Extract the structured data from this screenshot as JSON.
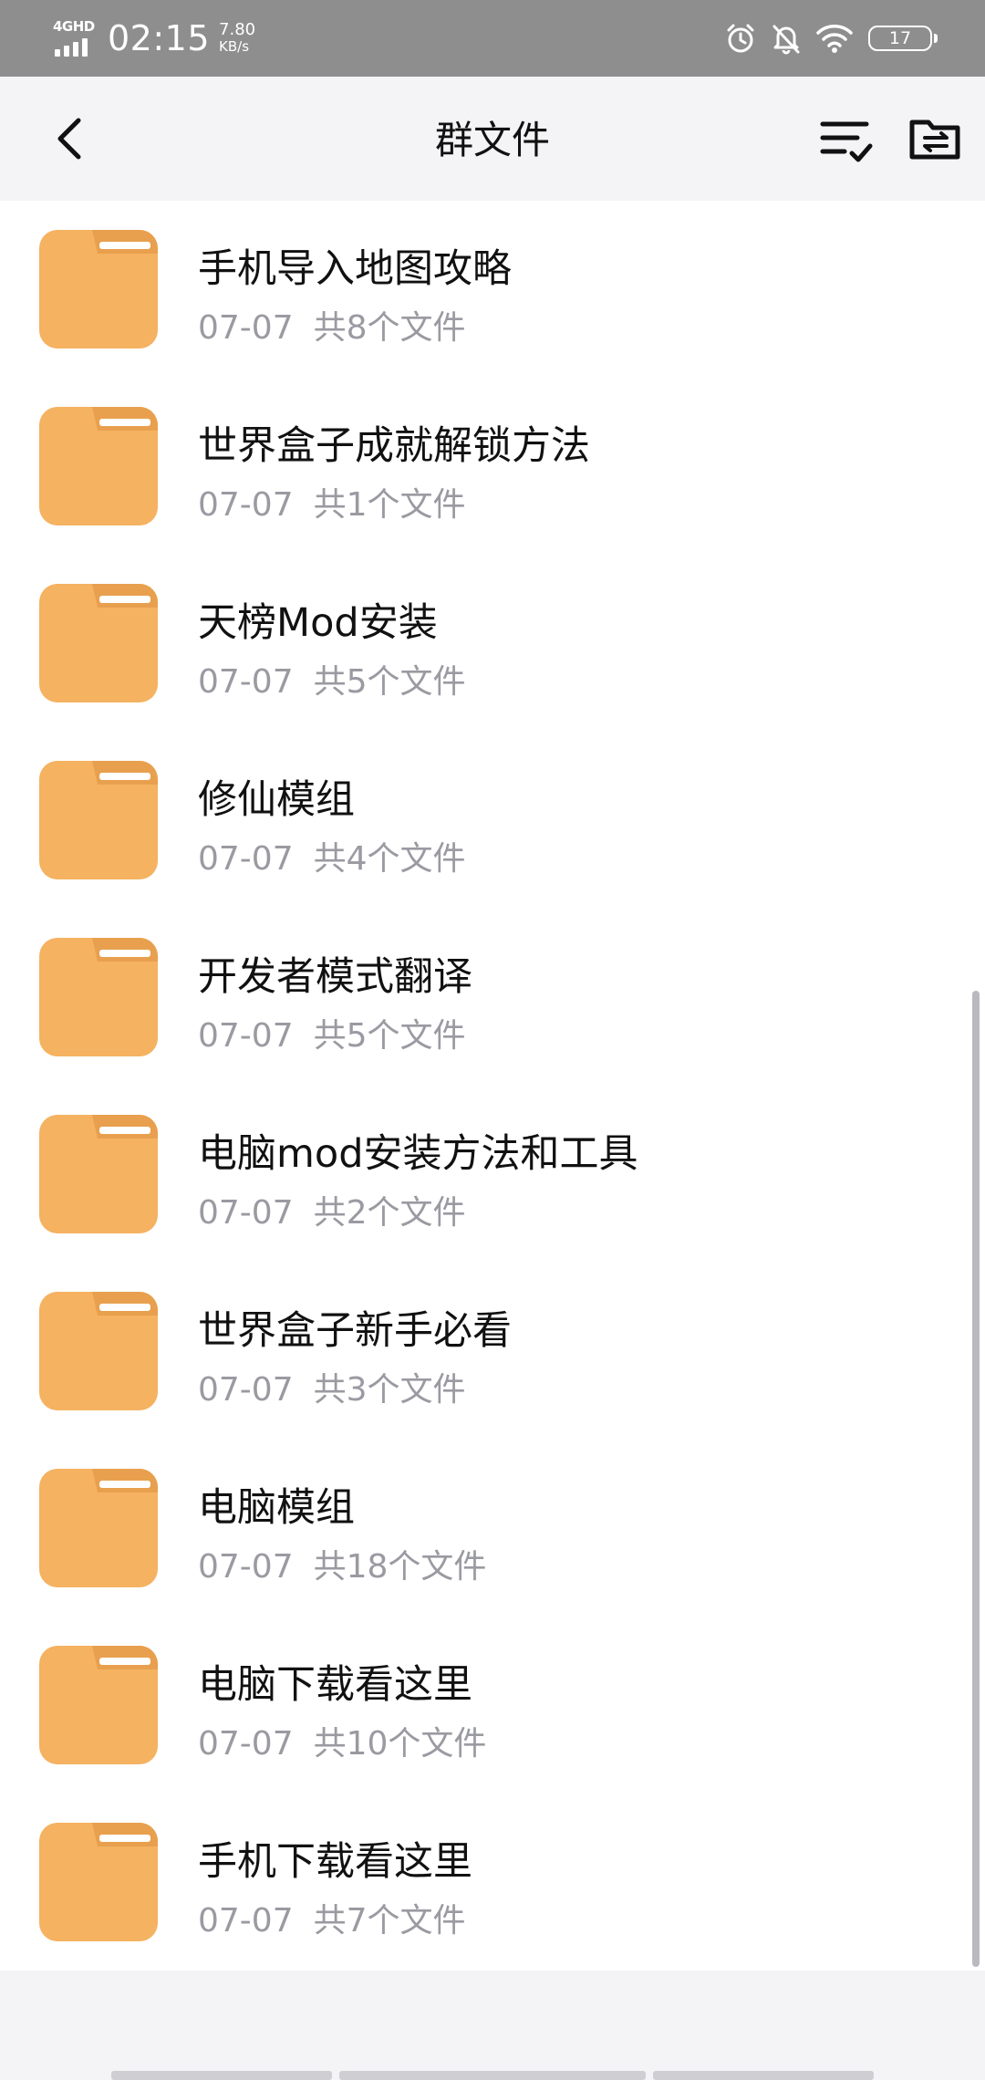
{
  "status_bar": {
    "network": "4GHD",
    "time": "02:15",
    "speed_value": "7.80",
    "speed_unit": "KB/s",
    "battery": "17"
  },
  "header": {
    "title": "群文件",
    "icons": {
      "back": "chevron-left-icon",
      "sort": "sort-list-check-icon",
      "folder_action": "folder-transfer-icon"
    }
  },
  "colors": {
    "folder": "#f5b261",
    "folder_tab": "#e8a04e",
    "status_bar": "#8e8e8e",
    "meta_text": "#9a9aa2"
  },
  "files": [
    {
      "name": "手机导入地图攻略",
      "date": "07-07",
      "count": "共8个文件"
    },
    {
      "name": "世界盒子成就解锁方法",
      "date": "07-07",
      "count": "共1个文件"
    },
    {
      "name": "天榜Mod安装",
      "date": "07-07",
      "count": "共5个文件"
    },
    {
      "name": "修仙模组",
      "date": "07-07",
      "count": "共4个文件"
    },
    {
      "name": "开发者模式翻译",
      "date": "07-07",
      "count": "共5个文件"
    },
    {
      "name": "电脑mod安装方法和工具",
      "date": "07-07",
      "count": "共2个文件"
    },
    {
      "name": "世界盒子新手必看",
      "date": "07-07",
      "count": "共3个文件"
    },
    {
      "name": "电脑模组",
      "date": "07-07",
      "count": "共18个文件"
    },
    {
      "name": "电脑下载看这里",
      "date": "07-07",
      "count": "共10个文件"
    },
    {
      "name": "手机下载看这里",
      "date": "07-07",
      "count": "共7个文件"
    }
  ]
}
